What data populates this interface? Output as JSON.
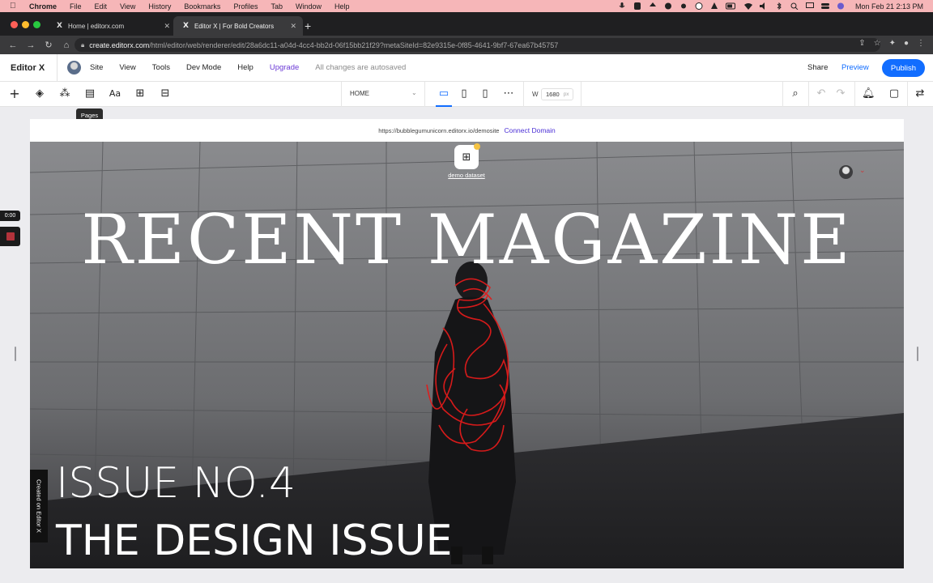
{
  "menubar": {
    "app": "Chrome",
    "items": [
      "File",
      "Edit",
      "View",
      "History",
      "Bookmarks",
      "Profiles",
      "Tab",
      "Window",
      "Help"
    ],
    "clock": "Mon Feb 21  2:13 PM"
  },
  "browser": {
    "tabs": [
      {
        "title": "Home | editorx.com",
        "favicon": "X"
      },
      {
        "title": "Editor X | For Bold Creators",
        "favicon": "X"
      }
    ],
    "url_host": "create.editorx.com",
    "url_path": "/html/editor/web/renderer/edit/28a6dc11-a04d-4cc4-bb2d-06f15bb21f29?metaSiteId=82e9315e-0f85-4641-9bf7-67ea67b45757"
  },
  "editor": {
    "logo": "Editor X",
    "menu": [
      "Site",
      "View",
      "Tools",
      "Dev Mode",
      "Help"
    ],
    "upgrade": "Upgrade",
    "autosave": "All changes are autosaved",
    "share": "Share",
    "preview": "Preview",
    "publish": "Publish"
  },
  "toolbar": {
    "page": "HOME",
    "width_label": "W",
    "width_value": "1680",
    "width_unit": "px",
    "tooltip": "Pages"
  },
  "site": {
    "url": "https://bubblegumunicorn.editorx.io/demosite",
    "connect_domain": "Connect Domain",
    "dataset_label": "demo dataset",
    "hero_title": "RECENT MAGAZINE",
    "issue_line1": "ISSUE NO.4",
    "issue_line2": "THE DESIGN ISSUE",
    "badge": "Created on Editor X"
  },
  "recorder": {
    "time": "0:00"
  },
  "colors": {
    "accent": "#116dff",
    "upgrade": "#6b39d6",
    "menubar": "#f6b6b8"
  }
}
